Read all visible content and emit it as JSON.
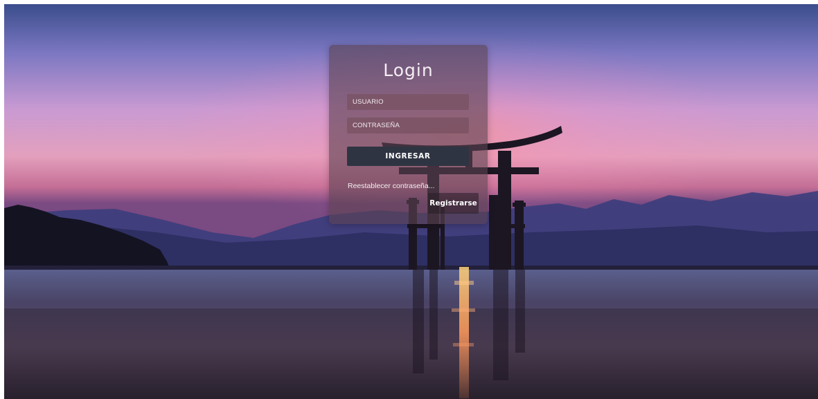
{
  "login": {
    "title": "Login",
    "username_placeholder": "USUARIO",
    "password_placeholder": "CONTRASEÑA",
    "submit_label": "INGRESAR",
    "reset_link": "Reestablecer contraseña...",
    "register_label": "Registrarse"
  },
  "theme": {
    "card_background": "#5c4250",
    "submit_button": "#2f3442",
    "sky_top": "#3a4d8c",
    "sky_glow": "#d99ac8"
  }
}
